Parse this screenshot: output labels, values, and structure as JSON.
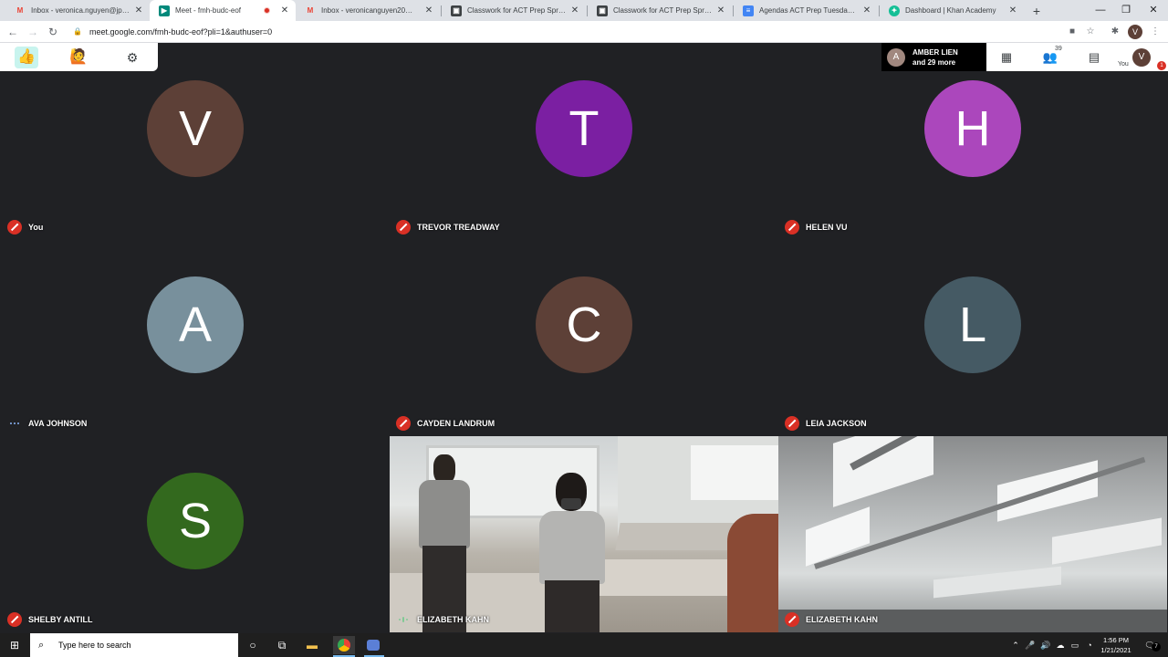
{
  "browser": {
    "tabs": [
      {
        "title": "Inbox - veronica.nguyen@jpscho",
        "icon": "gmail-icon",
        "active": false
      },
      {
        "title": "Meet - fmh-budc-eof",
        "icon": "meet-icon",
        "active": true,
        "recording": true
      },
      {
        "title": "Inbox - veronicanguyen20@gma",
        "icon": "gmail-icon",
        "active": false
      },
      {
        "title": "Classwork for ACT Prep Spring 2",
        "icon": "classroom-icon",
        "active": false
      },
      {
        "title": "Classwork for ACT Prep Spring 2",
        "icon": "classroom-icon",
        "active": false
      },
      {
        "title": "Agendas ACT Prep Tuesday, Janu",
        "icon": "docs-icon",
        "active": false
      },
      {
        "title": "Dashboard | Khan Academy",
        "icon": "khan-icon",
        "active": false
      }
    ],
    "url": "meet.google.com/fmh-budc-eof?pli=1&authuser=0",
    "profile_initial": "V"
  },
  "meet": {
    "presenter": {
      "initial": "A",
      "line1": "AMBER LIEN",
      "line2": "and 29 more"
    },
    "participant_count": "39",
    "you_label": "You",
    "self_initial": "V",
    "notification_count": "1",
    "tiles": [
      {
        "name": "You",
        "initial": "V",
        "color": "#5d4037",
        "muted": true
      },
      {
        "name": "TREVOR TREADWAY",
        "initial": "T",
        "color": "#7b1fa2",
        "muted": true
      },
      {
        "name": "HELEN VU",
        "initial": "H",
        "color": "#ab47bc",
        "muted": true
      },
      {
        "name": "AVA JOHNSON",
        "initial": "A",
        "color": "#78909c",
        "muted": false
      },
      {
        "name": "CAYDEN LANDRUM",
        "initial": "C",
        "color": "#5d4037",
        "muted": true
      },
      {
        "name": "LEIA JACKSON",
        "initial": "L",
        "color": "#455a64",
        "muted": true
      },
      {
        "name": "SHELBY ANTILL",
        "initial": "S",
        "color": "#33691e",
        "muted": true
      },
      {
        "name": "ELIZABETH KAHN",
        "video": true,
        "muted": false
      },
      {
        "name": "ELIZABETH KAHN",
        "video": true,
        "muted": true
      }
    ]
  },
  "taskbar": {
    "search_placeholder": "Type here to search",
    "time": "1:56 PM",
    "date": "1/21/2021",
    "notif_count": "7"
  }
}
